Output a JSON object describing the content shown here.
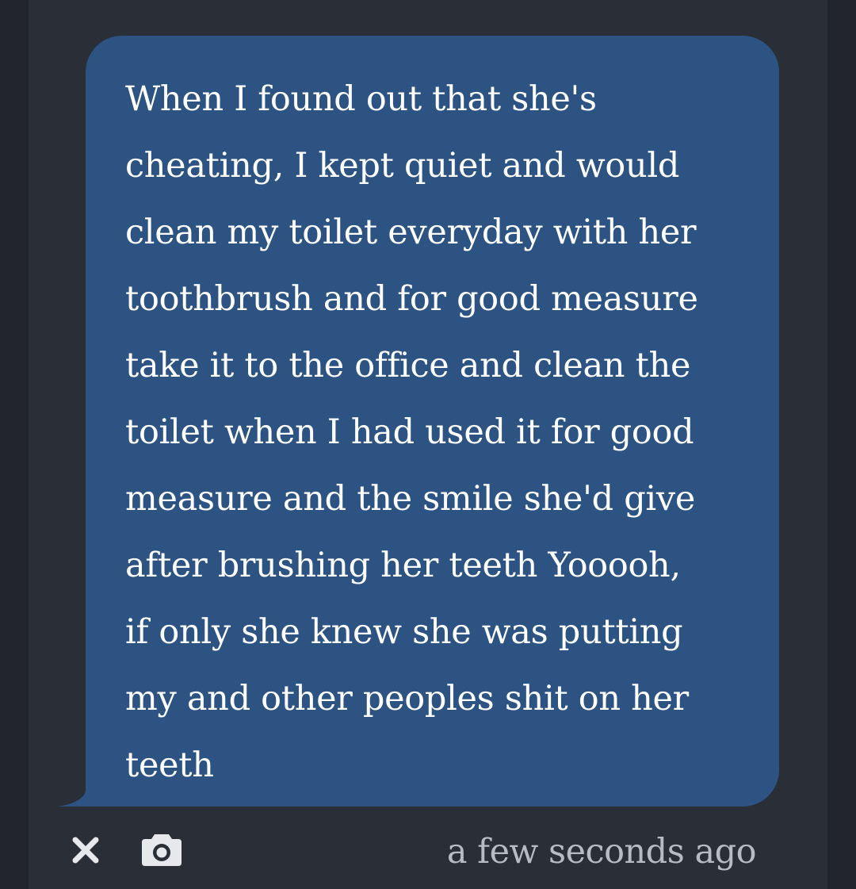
{
  "message": {
    "text": "When I found out that she's\ncheating, I kept quiet and would\nclean my toilet everyday with her\ntoothbrush and for good measure\ntake it to the office and clean the\ntoilet when I had used it for good\nmeasure and the smile she'd give\nafter brushing her teeth Yooooh,\nif only she knew she was putting\nmy and other peoples shit on her\nteeth",
    "bubble_color": "#2c5382",
    "text_color": "#ffffff"
  },
  "footer": {
    "close_icon": "close-icon",
    "camera_icon": "camera-icon",
    "timestamp": "a few seconds ago"
  },
  "colors": {
    "background": "#2a2e36",
    "icon": "#e6e8eb",
    "timestamp": "#b7bcc4"
  }
}
